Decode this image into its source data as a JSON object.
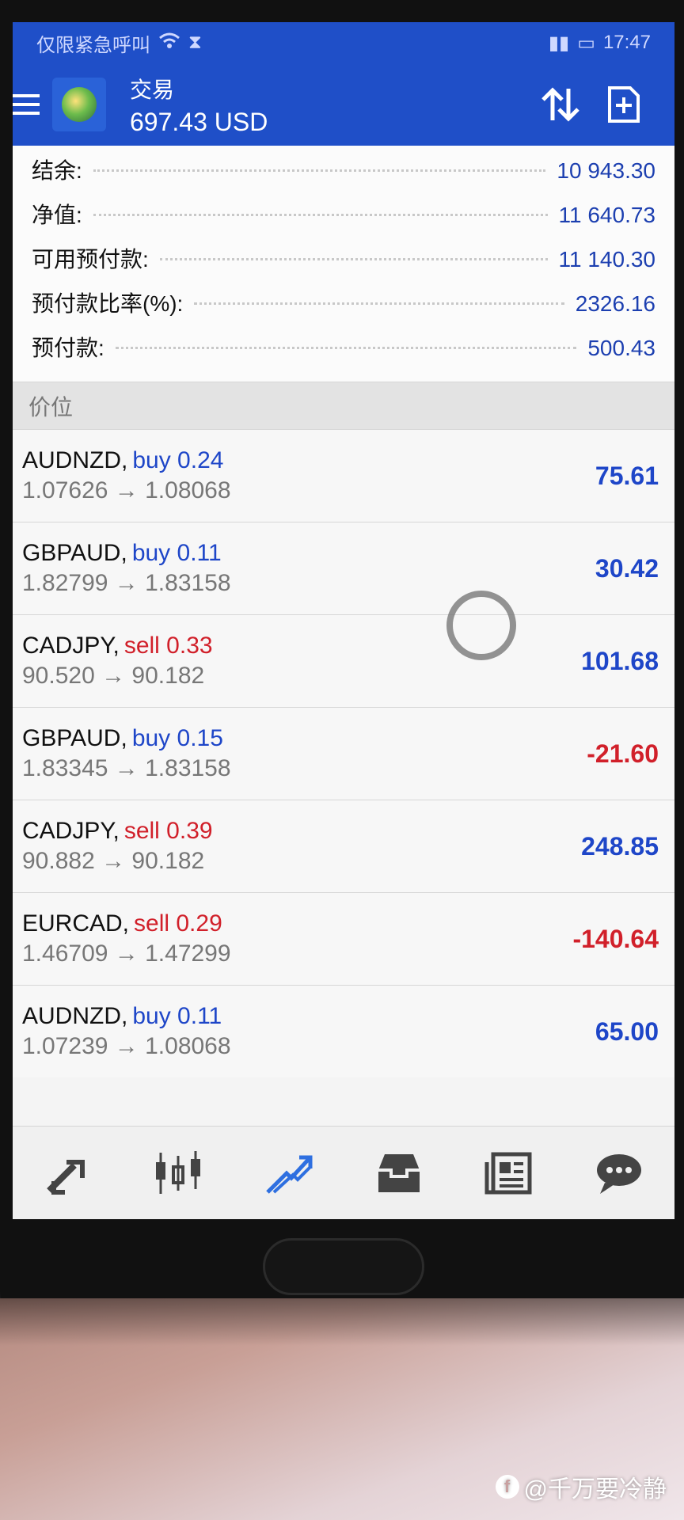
{
  "status_bar": {
    "left_text": "仅限紧急呼叫",
    "time": "17:47"
  },
  "app_bar": {
    "title": "交易",
    "balance_line": "697.43 USD"
  },
  "summary": [
    {
      "label": "结余:",
      "value": "10 943.30"
    },
    {
      "label": "净值:",
      "value": "11 640.73"
    },
    {
      "label": "可用预付款:",
      "value": "11 140.30"
    },
    {
      "label": "预付款比率(%):",
      "value": "2326.16"
    },
    {
      "label": "预付款:",
      "value": "500.43"
    }
  ],
  "section_title": "价位",
  "positions": [
    {
      "symbol": "AUDNZD,",
      "side": "buy 0.24",
      "prices": "1.07626 → 1.08068",
      "profit": "75.61"
    },
    {
      "symbol": "GBPAUD,",
      "side": "buy 0.11",
      "prices": "1.82799 → 1.83158",
      "profit": "30.42"
    },
    {
      "symbol": "CADJPY,",
      "side": "sell 0.33",
      "prices": "90.520 → 90.182",
      "profit": "101.68"
    },
    {
      "symbol": "GBPAUD,",
      "side": "buy 0.15",
      "prices": "1.83345 → 1.83158",
      "profit": "-21.60"
    },
    {
      "symbol": "CADJPY,",
      "side": "sell 0.39",
      "prices": "90.882 → 90.182",
      "profit": "248.85"
    },
    {
      "symbol": "EURCAD,",
      "side": "sell 0.29",
      "prices": "1.46709 → 1.47299",
      "profit": "-140.64"
    },
    {
      "symbol": "AUDNZD,",
      "side": "buy 0.11",
      "prices": "1.07239 → 1.08068",
      "profit": "65.00"
    }
  ],
  "bottom_nav": [
    "quotes-icon",
    "chart-icon",
    "trade-icon",
    "history-icon",
    "news-icon",
    "chat-icon"
  ],
  "watermark": "@千万要冷静",
  "colors": {
    "app_bar": "#1f4fc8",
    "buy": "#1e46c8",
    "sell": "#d1202a"
  }
}
